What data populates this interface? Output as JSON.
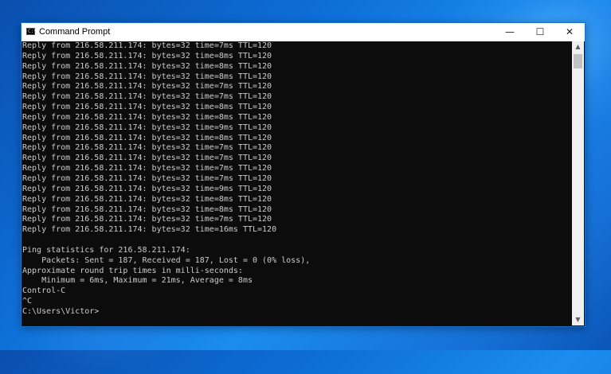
{
  "window": {
    "title": "Command Prompt",
    "app_icon_text": "C:\\",
    "controls": {
      "minimize": "—",
      "maximize": "☐",
      "close": "✕"
    }
  },
  "scrollbar": {
    "up_arrow": "▲",
    "down_arrow": "▼"
  },
  "console": {
    "lines": [
      "Reply from 216.58.211.174: bytes=32 time=7ms TTL=120",
      "Reply from 216.58.211.174: bytes=32 time=8ms TTL=120",
      "Reply from 216.58.211.174: bytes=32 time=8ms TTL=120",
      "Reply from 216.58.211.174: bytes=32 time=8ms TTL=120",
      "Reply from 216.58.211.174: bytes=32 time=7ms TTL=120",
      "Reply from 216.58.211.174: bytes=32 time=7ms TTL=120",
      "Reply from 216.58.211.174: bytes=32 time=8ms TTL=120",
      "Reply from 216.58.211.174: bytes=32 time=8ms TTL=120",
      "Reply from 216.58.211.174: bytes=32 time=9ms TTL=120",
      "Reply from 216.58.211.174: bytes=32 time=8ms TTL=120",
      "Reply from 216.58.211.174: bytes=32 time=7ms TTL=120",
      "Reply from 216.58.211.174: bytes=32 time=7ms TTL=120",
      "Reply from 216.58.211.174: bytes=32 time=7ms TTL=120",
      "Reply from 216.58.211.174: bytes=32 time=7ms TTL=120",
      "Reply from 216.58.211.174: bytes=32 time=9ms TTL=120",
      "Reply from 216.58.211.174: bytes=32 time=8ms TTL=120",
      "Reply from 216.58.211.174: bytes=32 time=8ms TTL=120",
      "Reply from 216.58.211.174: bytes=32 time=7ms TTL=120",
      "Reply from 216.58.211.174: bytes=32 time=16ms TTL=120",
      "",
      "Ping statistics for 216.58.211.174:",
      "    Packets: Sent = 187, Received = 187, Lost = 0 (0% loss),",
      "Approximate round trip times in milli-seconds:",
      "    Minimum = 6ms, Maximum = 21ms, Average = 8ms",
      "Control-C",
      "^C",
      "C:\\Users\\Victor>"
    ]
  },
  "colors": {
    "console_background": "#0c0c0c",
    "console_text": "#cccccc",
    "titlebar": "#ffffff",
    "desktop": "#0d6fd8"
  }
}
